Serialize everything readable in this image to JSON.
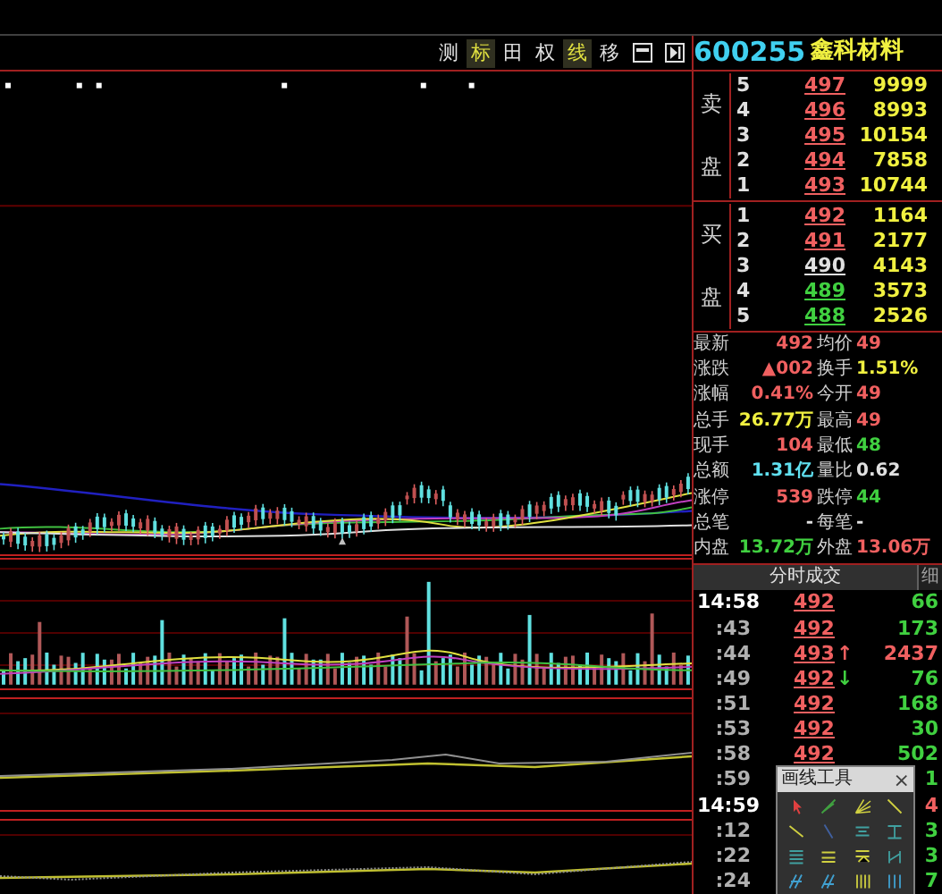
{
  "toolbar": [
    {
      "label": "测",
      "selected": false
    },
    {
      "label": "标",
      "selected": true
    },
    {
      "label": "田",
      "selected": false
    },
    {
      "label": "权",
      "selected": false
    },
    {
      "label": "线",
      "selected": true
    },
    {
      "label": "移",
      "selected": false
    }
  ],
  "stock": {
    "code": "600255",
    "name": "鑫科材料"
  },
  "sell": {
    "labels": [
      "卖",
      "盘"
    ],
    "rows": [
      {
        "level": "5",
        "price": "497",
        "color": "#f06060",
        "volume": "9999"
      },
      {
        "level": "4",
        "price": "496",
        "color": "#f06060",
        "volume": "8993"
      },
      {
        "level": "3",
        "price": "495",
        "color": "#f06060",
        "volume": "10154"
      },
      {
        "level": "2",
        "price": "494",
        "color": "#f06060",
        "volume": "7858"
      },
      {
        "level": "1",
        "price": "493",
        "color": "#f06060",
        "volume": "10744"
      }
    ]
  },
  "buy": {
    "labels": [
      "买",
      "盘"
    ],
    "rows": [
      {
        "level": "1",
        "price": "492",
        "color": "#f06060",
        "volume": "1164"
      },
      {
        "level": "2",
        "price": "491",
        "color": "#f06060",
        "volume": "2177"
      },
      {
        "level": "3",
        "price": "490",
        "color": "#e0e0e0",
        "volume": "4143"
      },
      {
        "level": "4",
        "price": "489",
        "color": "#40d040",
        "volume": "3573"
      },
      {
        "level": "5",
        "price": "488",
        "color": "#40d040",
        "volume": "2526"
      }
    ]
  },
  "stats": [
    [
      {
        "label": "最新",
        "value": "492",
        "color": "#f06060"
      },
      {
        "label": "均价",
        "value": "49",
        "color": "#f06060"
      }
    ],
    [
      {
        "label": "涨跌",
        "value": "▲002",
        "color": "#f06060"
      },
      {
        "label": "换手",
        "value": "1.51%",
        "color": "#f0f040"
      }
    ],
    [
      {
        "label": "涨幅",
        "value": "0.41%",
        "color": "#f06060"
      },
      {
        "label": "今开",
        "value": "49",
        "color": "#f06060"
      }
    ],
    [
      {
        "label": "总手",
        "value": "26.77万",
        "color": "#f0f040"
      },
      {
        "label": "最高",
        "value": "49",
        "color": "#f06060"
      }
    ],
    [
      {
        "label": "现手",
        "value": "104",
        "color": "#f06060"
      },
      {
        "label": "最低",
        "value": "48",
        "color": "#40d040"
      }
    ],
    [
      {
        "label": "总额",
        "value": "1.31亿",
        "color": "#60e0f0"
      },
      {
        "label": "量比",
        "value": "0.62",
        "color": "#e0e0e0"
      }
    ],
    [
      {
        "label": "涨停",
        "value": "539",
        "color": "#f06060"
      },
      {
        "label": "跌停",
        "value": "44",
        "color": "#40d040"
      }
    ],
    [
      {
        "label": "总笔",
        "value": "-",
        "color": "#e0e0e0"
      },
      {
        "label": "每笔",
        "value": "-",
        "color": "#e0e0e0"
      }
    ],
    [
      {
        "label": "内盘",
        "value": "13.72万",
        "color": "#40d040"
      },
      {
        "label": "外盘",
        "value": "13.06万",
        "color": "#f06060"
      }
    ]
  ],
  "trades_tabs": [
    {
      "label": "分时成交",
      "selected": true
    },
    {
      "label": "细",
      "selected": false
    }
  ],
  "trades": [
    {
      "time": "14:58",
      "price": "492",
      "volume": "66",
      "color": "#40d040"
    },
    {
      "time": ":43",
      "price": "492",
      "volume": "173",
      "color": "#40d040"
    },
    {
      "time": ":44",
      "price": "493",
      "arrow": "↑",
      "volume": "2437",
      "color": "#f06060"
    },
    {
      "time": ":49",
      "price": "492",
      "arrow": "↓",
      "volume": "76",
      "color": "#40d040"
    },
    {
      "time": ":51",
      "price": "492",
      "volume": "168",
      "color": "#40d040"
    },
    {
      "time": ":53",
      "price": "492",
      "volume": "30",
      "color": "#40d040"
    },
    {
      "time": ":58",
      "price": "492",
      "volume": "502",
      "color": "#40d040"
    },
    {
      "time": ":59",
      "volume": "1",
      "color": "#40d040"
    },
    {
      "time": "14:59",
      "volume": "4",
      "color": "#f06060"
    },
    {
      "time": ":12",
      "volume": "3",
      "color": "#40d040"
    },
    {
      "time": ":22",
      "volume": "3",
      "color": "#40d040"
    },
    {
      "time": ":24",
      "volume": "7",
      "color": "#40d040"
    }
  ],
  "drawing_tools": {
    "title": "画线工具",
    "close": "×"
  }
}
